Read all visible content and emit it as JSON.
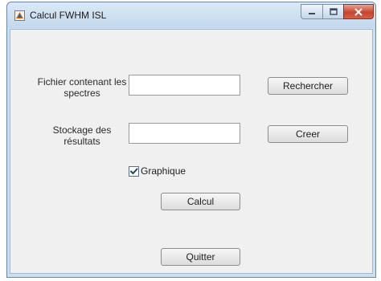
{
  "window": {
    "title": "Calcul FWHM ISL",
    "icon": "matlab-figure-icon",
    "controls": {
      "minimize": "minimize-icon",
      "maximize": "maximize-icon",
      "close": "close-icon"
    }
  },
  "form": {
    "file_label": "Fichier contenant les spectres",
    "file_value": "",
    "browse_button": "Rechercher",
    "storage_label": "Stockage des résultats",
    "storage_value": "",
    "create_button": "Creer",
    "graph_checkbox": {
      "label": "Graphique",
      "checked": true
    },
    "calc_button": "Calcul",
    "quit_button": "Quitter"
  },
  "colors": {
    "titlebar": "#c3d8ec",
    "client": "#f0f0f0",
    "close_button": "#c7452d"
  }
}
